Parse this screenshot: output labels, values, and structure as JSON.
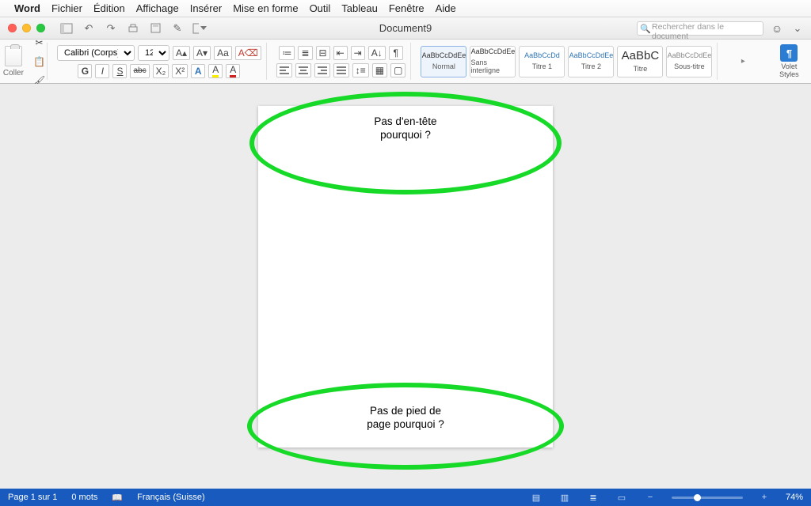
{
  "menubar": {
    "app": "Word",
    "items": [
      "Fichier",
      "Édition",
      "Affichage",
      "Insérer",
      "Mise en forme",
      "Outil",
      "Tableau",
      "Fenêtre",
      "Aide"
    ]
  },
  "titlebar": {
    "doc_title": "Document9",
    "search_placeholder": "Rechercher dans le document"
  },
  "ribbon": {
    "paste_label": "Coller",
    "font_name": "Calibri (Corps)",
    "font_size": "12",
    "bold": "G",
    "italic": "I",
    "underline": "S",
    "strike": "abc",
    "sub": "X₂",
    "sup": "X²",
    "styles": [
      {
        "preview": "AaBbCcDdEe",
        "name": "Normal",
        "selected": true,
        "big": false
      },
      {
        "preview": "AaBbCcDdEe",
        "name": "Sans interligne",
        "selected": false,
        "big": false
      },
      {
        "preview": "AaBbCcDd",
        "name": "Titre 1",
        "selected": false,
        "big": false,
        "color": "#2e74b5"
      },
      {
        "preview": "AaBbCcDdEe",
        "name": "Titre 2",
        "selected": false,
        "big": false,
        "color": "#2e74b5"
      },
      {
        "preview": "AaBbC",
        "name": "Titre",
        "selected": false,
        "big": true
      },
      {
        "preview": "AaBbCcDdEe",
        "name": "Sous-titre",
        "selected": false,
        "big": false,
        "color": "#888"
      }
    ],
    "volet_l1": "Volet",
    "volet_l2": "Styles"
  },
  "page": {
    "header_l1": "Pas d'en-tête",
    "header_l2": "pourquoi ?",
    "footer_l1": "Pas de pied de",
    "footer_l2": "page pourquoi ?"
  },
  "status": {
    "page": "Page 1 sur 1",
    "words": "0 mots",
    "lang": "Français (Suisse)",
    "zoom": "74%"
  }
}
